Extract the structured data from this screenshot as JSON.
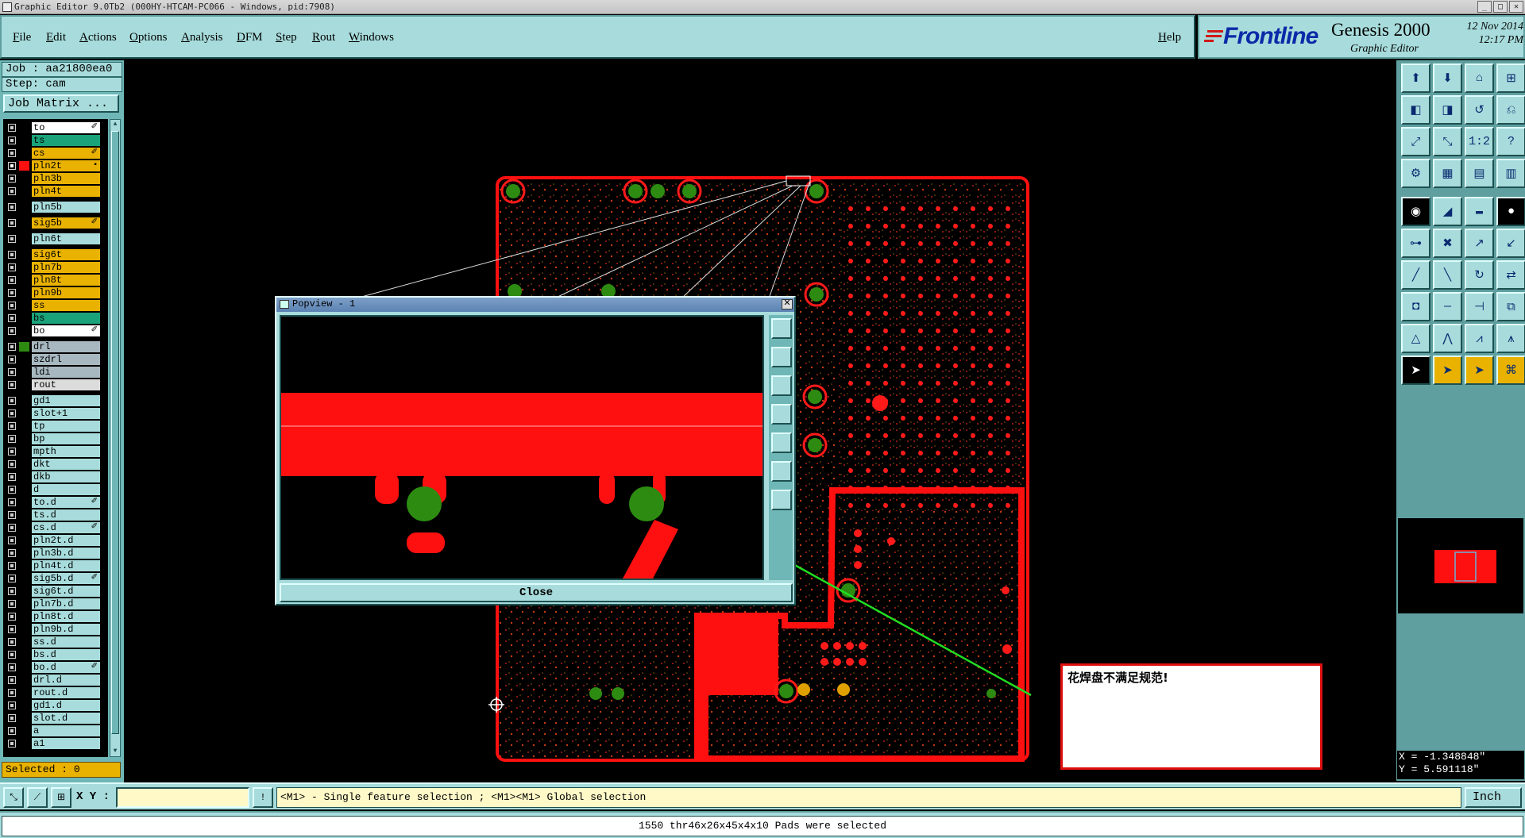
{
  "window": {
    "title": "Graphic Editor 9.0Tb2 (000HY-HTCAM-PC066 - Windows, pid:7908)"
  },
  "menu": [
    "File",
    "Edit",
    "Actions",
    "Options",
    "Analysis",
    "DFM",
    "Step",
    "Rout",
    "Windows"
  ],
  "help_label": "Help",
  "brand": {
    "logo_text": "Frontline",
    "product": "Genesis 2000",
    "subtitle": "Graphic Editor",
    "date": "12 Nov 2014",
    "time": "12:17 PM"
  },
  "job": {
    "job_label": "Job : aa21800ea0",
    "step_label": "Step: cam",
    "matrix_button": "Job Matrix ..."
  },
  "layers": [
    {
      "name": "to",
      "color": "#ffffff",
      "flag": "✐"
    },
    {
      "name": "ts",
      "color": "#1aa37a",
      "flag": ""
    },
    {
      "name": "cs",
      "color": "#e9b200",
      "flag": "✐"
    },
    {
      "name": "pln2t",
      "color": "#e9b200",
      "flag": "▪",
      "active": true
    },
    {
      "name": "pln3b",
      "color": "#e9b200",
      "flag": ""
    },
    {
      "name": "pln4t",
      "color": "#e9b200",
      "flag": ""
    },
    {
      "name": "pln5b",
      "color": "#a8dcdc",
      "flag": ""
    },
    {
      "name": "sig5b",
      "color": "#e9b200",
      "flag": "✐"
    },
    {
      "name": "pln6t",
      "color": "#a8dcdc",
      "flag": ""
    },
    {
      "name": "sig6t",
      "color": "#e9b200",
      "flag": ""
    },
    {
      "name": "pln7b",
      "color": "#e9b200",
      "flag": ""
    },
    {
      "name": "pln8t",
      "color": "#e9b200",
      "flag": ""
    },
    {
      "name": "pln9b",
      "color": "#e9b200",
      "flag": ""
    },
    {
      "name": "ss",
      "color": "#e9b200",
      "flag": ""
    },
    {
      "name": "bs",
      "color": "#1aa37a",
      "flag": ""
    },
    {
      "name": "bo",
      "color": "#ffffff",
      "flag": "✐"
    },
    {
      "name": "drl",
      "color": "#a8b8c0",
      "flag": ""
    },
    {
      "name": "szdrl",
      "color": "#a8b8c0",
      "flag": ""
    },
    {
      "name": "ldi",
      "color": "#a8b8c0",
      "flag": ""
    },
    {
      "name": "rout",
      "color": "#dcdcdc",
      "flag": ""
    },
    {
      "name": "gd1",
      "color": "#a8dcdc",
      "flag": ""
    },
    {
      "name": "slot+1",
      "color": "#a8dcdc",
      "flag": ""
    },
    {
      "name": "tp",
      "color": "#a8dcdc",
      "flag": ""
    },
    {
      "name": "bp",
      "color": "#a8dcdc",
      "flag": ""
    },
    {
      "name": "mpth",
      "color": "#a8dcdc",
      "flag": ""
    },
    {
      "name": "dkt",
      "color": "#a8dcdc",
      "flag": ""
    },
    {
      "name": "dkb",
      "color": "#a8dcdc",
      "flag": ""
    },
    {
      "name": "d",
      "color": "#a8dcdc",
      "flag": ""
    },
    {
      "name": "to.d",
      "color": "#a8dcdc",
      "flag": "✐"
    },
    {
      "name": "ts.d",
      "color": "#a8dcdc",
      "flag": ""
    },
    {
      "name": "cs.d",
      "color": "#a8dcdc",
      "flag": "✐"
    },
    {
      "name": "pln2t.d",
      "color": "#a8dcdc",
      "flag": ""
    },
    {
      "name": "pln3b.d",
      "color": "#a8dcdc",
      "flag": ""
    },
    {
      "name": "pln4t.d",
      "color": "#a8dcdc",
      "flag": ""
    },
    {
      "name": "sig5b.d",
      "color": "#a8dcdc",
      "flag": "✐"
    },
    {
      "name": "sig6t.d",
      "color": "#a8dcdc",
      "flag": ""
    },
    {
      "name": "pln7b.d",
      "color": "#a8dcdc",
      "flag": ""
    },
    {
      "name": "pln8t.d",
      "color": "#a8dcdc",
      "flag": ""
    },
    {
      "name": "pln9b.d",
      "color": "#a8dcdc",
      "flag": ""
    },
    {
      "name": "ss.d",
      "color": "#a8dcdc",
      "flag": ""
    },
    {
      "name": "bs.d",
      "color": "#a8dcdc",
      "flag": ""
    },
    {
      "name": "bo.d",
      "color": "#a8dcdc",
      "flag": "✐"
    },
    {
      "name": "drl.d",
      "color": "#a8dcdc",
      "flag": ""
    },
    {
      "name": "rout.d",
      "color": "#a8dcdc",
      "flag": ""
    },
    {
      "name": "gd1.d",
      "color": "#a8dcdc",
      "flag": ""
    },
    {
      "name": "slot.d",
      "color": "#a8dcdc",
      "flag": ""
    },
    {
      "name": "a",
      "color": "#a8dcdc",
      "flag": ""
    },
    {
      "name": "a1",
      "color": "#a8dcdc",
      "flag": ""
    }
  ],
  "selected_label": "Selected : 0",
  "popview": {
    "title": "Popview - 1",
    "close_label": "Close"
  },
  "note_text": "花焊盘不满足规范!",
  "coords": {
    "x": "X = -1.348848\"",
    "y": "Y = 5.591118\""
  },
  "bottom": {
    "xy_label": "X Y :",
    "xy_value": "",
    "prompt": "<M1> - Single feature selection ; <M1><M1> Global selection",
    "unit": "Inch"
  },
  "status_message": "1550 thr46x26x45x4x10 Pads were selected",
  "colors": {
    "panel": "#a8dcdc",
    "board": "#ff1010",
    "pad_green": "#2e8b12",
    "arrow": "#22dd22"
  },
  "icons": {
    "right_tools": [
      "open-icon",
      "save-icon",
      "home-icon",
      "window-icon",
      "left-icon",
      "right-icon",
      "undo-icon",
      "redraw-icon",
      "zoom-fit-icon",
      "zoom-home-icon",
      "scale-icon",
      "help-icon",
      "snap-icon",
      "grid-icon",
      "layers-icon",
      "layers2-icon",
      "pad-icon",
      "line-icon",
      "measure-icon",
      "circle-icon",
      "node-icon",
      "cross-icon",
      "move-icon",
      "rotate-icon",
      "arc-icon",
      "edit-icon",
      "copy-icon",
      "mirror-icon",
      "attr-icon",
      "split-icon",
      "resize-icon",
      "group-icon",
      "poly-icon",
      "poly2-icon",
      "poly3-icon",
      "poly4-icon",
      "select-icon",
      "select2-icon",
      "select3-icon",
      "select4-icon"
    ]
  }
}
